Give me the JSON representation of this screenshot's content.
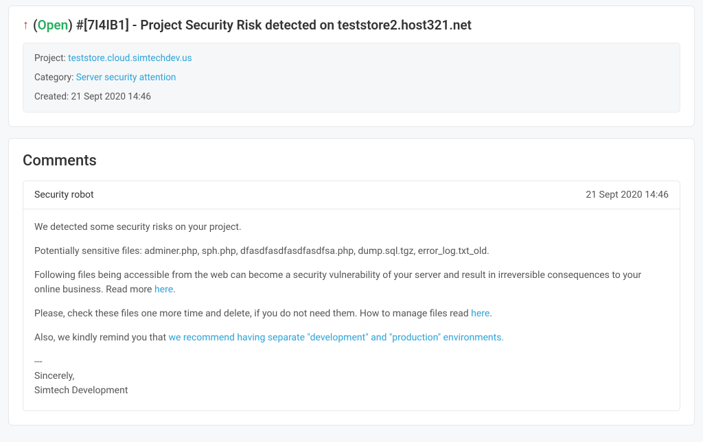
{
  "ticket": {
    "arrow": "↑",
    "status_open_paren": "(",
    "status_text": "Open",
    "status_close_paren": ")",
    "title_rest": " #[7I4IB1] - Project Security Risk detected on teststore2.host321.net",
    "meta": {
      "project_label": "Project: ",
      "project_link": "teststore.cloud.simtechdev.us",
      "category_label": "Category: ",
      "category_link": "Server security attention",
      "created_label": "Created: ",
      "created_value": "21 Sept 2020 14:46"
    }
  },
  "comments": {
    "heading": "Comments",
    "items": [
      {
        "author": "Security robot",
        "date": "21 Sept 2020 14:46",
        "body": {
          "p1": "We detected some security risks on your project.",
          "p2_prefix": "Potentially sensitive files: ",
          "p2_files": "adminer.php, sph.php, dfasdfasdfasdfasdfsa.php, dump.sql.tgz, error_log.txt_old",
          "p2_suffix": ".",
          "p3_text": "Following files being accessible from the web can become a security vulnerability of your server and result in irreversible consequences to your online business. Read more ",
          "p3_link": "here",
          "p3_suffix": ".",
          "p4_text": "Please, check these files one more time and delete, if you do not need them. How to manage files read ",
          "p4_link": "here",
          "p4_suffix": ".",
          "p5_text": "Also, we kindly remind you that ",
          "p5_link": "we recommend having separate \"development\" and \"production\" environments.",
          "sig_dashes": "---",
          "sig_line1": "Sincerely,",
          "sig_line2": "Simtech Development"
        }
      }
    ]
  }
}
